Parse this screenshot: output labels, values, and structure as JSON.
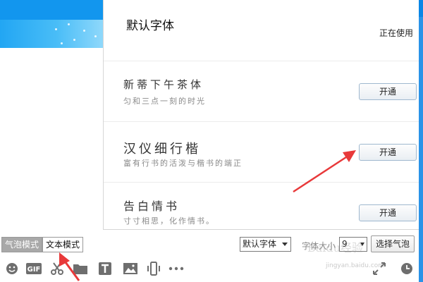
{
  "font_panel": {
    "default_font_name": "默认字体",
    "in_use_label": "正在使用",
    "fonts": [
      {
        "name": "新蒂下午茶体",
        "description": "匀和三点一刻的时光",
        "button_label": "开通"
      },
      {
        "name": "汉仪细行楷",
        "description": "富有行书的活泼与楷书的端正",
        "button_label": "开通"
      },
      {
        "name": "告白情书",
        "description": "寸寸相思，化作情书。",
        "button_label": "开通"
      }
    ]
  },
  "toolbar": {
    "bubble_mode_label": "气泡模式",
    "text_mode_label": "文本模式",
    "font_select_value": "默认字体",
    "font_size_label": "字体大小",
    "font_size_value": "9",
    "select_bubble_label": "选择气泡",
    "icons": [
      "emoji-icon",
      "gif-icon",
      "scissors-icon",
      "folder-icon",
      "font-icon",
      "image-icon",
      "shake-icon",
      "more-icon",
      "expand-icon",
      "history-clock-icon"
    ]
  },
  "watermark": {
    "brand": "Baidu经验",
    "url": "jingyan.baidu.com"
  },
  "colors": {
    "accent_blue": "#1296ee",
    "annotation_red": "#e8393a",
    "active_mode": "#a8a8a8"
  }
}
